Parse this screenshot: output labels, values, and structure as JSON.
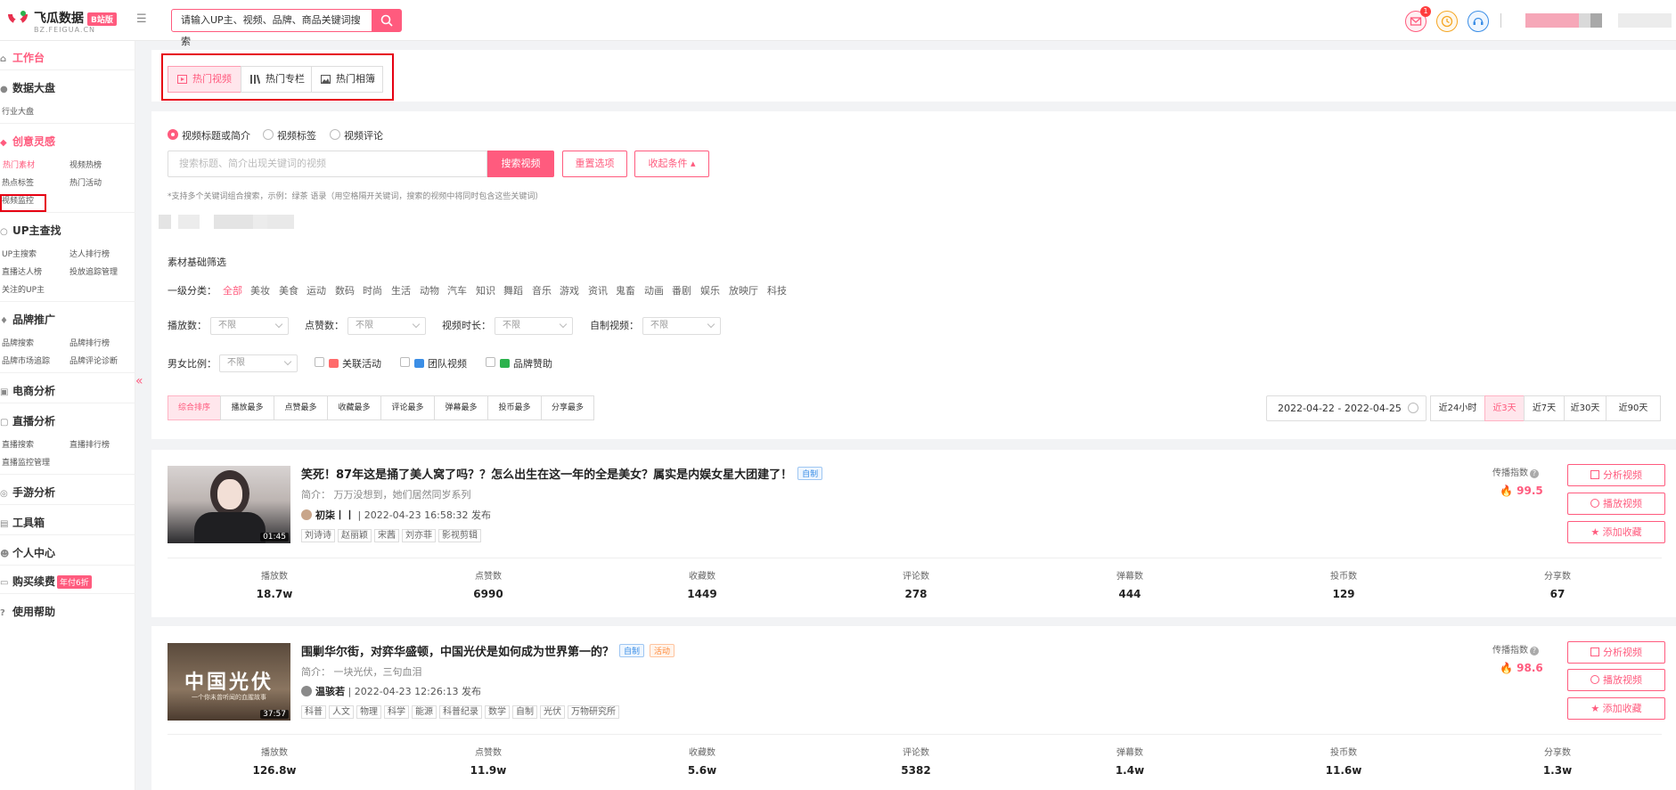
{
  "header": {
    "brand": "飞瓜数据",
    "brand_badge": "B站版",
    "brand_sub": "BZ.FEIGUA.CN",
    "search_placeholder": "请输入UP主、视频、品牌、商品关键词搜索",
    "notify_count": "1"
  },
  "sidebar": {
    "workbench": "工作台",
    "data_board": "数据大盘",
    "industry_board": "行业大盘",
    "inspiration": "创意灵感",
    "hot_material": "热门素材",
    "video_rank": "视频热榜",
    "hot_tags": "热点标签",
    "hot_activity": "热门活动",
    "video_monitor": "视频监控",
    "up_search": "UP主查找",
    "up_search_item": "UP主搜索",
    "talent_rank": "达人排行榜",
    "live_talent": "直播达人榜",
    "ad_manage": "投放追踪管理",
    "followed_up": "关注的UP主",
    "brand_promo": "品牌推广",
    "brand_search": "品牌搜索",
    "brand_rank": "品牌排行榜",
    "brand_market": "品牌市场追踪",
    "brand_diag": "品牌评论诊断",
    "ecommerce": "电商分析",
    "live_analysis": "直播分析",
    "live_search": "直播搜索",
    "live_rank": "直播排行榜",
    "live_monitor": "直播监控管理",
    "game_analysis": "手游分析",
    "toolbox": "工具箱",
    "personal": "个人中心",
    "buy_renew": "购买续费",
    "buy_badge": "年付6折",
    "help": "使用帮助"
  },
  "tabs": [
    "热门视频",
    "热门专栏",
    "热门相簿"
  ],
  "search_modes": [
    "视频标题或简介",
    "视频标签",
    "视频评论"
  ],
  "keyword_placeholder": "搜索标题、简介出现关键词的视频",
  "buttons": {
    "search": "搜索视频",
    "reset": "重置选项",
    "collapse": "收起条件"
  },
  "hint": "*支持多个关键词组合搜索，示例：绿茶 语录（用空格隔开关键词，搜索的视频中将同时包含这些关键词）",
  "filters": {
    "title": "素材基础筛选",
    "cat_label": "一级分类：",
    "categories": [
      "全部",
      "美妆",
      "美食",
      "运动",
      "数码",
      "时尚",
      "生活",
      "动物",
      "汽车",
      "知识",
      "舞蹈",
      "音乐",
      "游戏",
      "资讯",
      "鬼畜",
      "动画",
      "番剧",
      "娱乐",
      "放映厅",
      "科技"
    ],
    "play_label": "播放数：",
    "like_label": "点赞数：",
    "duration_label": "视频时长：",
    "self_label": "自制视频：",
    "gender_label": "男女比例：",
    "default_value": "不限",
    "related_activity": "关联活动",
    "team_video": "团队视频",
    "brand_sponsor": "品牌赞助"
  },
  "sort_tabs": [
    "综合排序",
    "播放最多",
    "点赞最多",
    "收藏最多",
    "评论最多",
    "弹幕最多",
    "投币最多",
    "分享最多"
  ],
  "date_range": "2022-04-22 - 2022-04-25",
  "range_tabs": [
    "近24小时",
    "近3天",
    "近7天",
    "近30天",
    "近90天"
  ],
  "video_labels": {
    "intro_prefix": "简介：",
    "spread": "传播指数",
    "analyze": "分析视频",
    "play": "播放视频",
    "collect": "添加收藏",
    "self_tag": "自制",
    "activity_tag": "活动",
    "stat_names": [
      "播放数",
      "点赞数",
      "收藏数",
      "评论数",
      "弹幕数",
      "投币数",
      "分享数"
    ]
  },
  "videos": [
    {
      "title": "笑死！87年这是捅了美人窝了吗？？怎么出生在这一年的全是美女？属实是内娱女星大团建了！",
      "intro": "万万没想到，她们居然同岁系列",
      "author": "初柒丨丨",
      "time": "| 2022-04-23 16:58:32 发布",
      "tags": [
        "刘诗诗",
        "赵丽颖",
        "宋茜",
        "刘亦菲",
        "影视剪辑"
      ],
      "duration": "01:45",
      "spread": "99.5",
      "stats": [
        "18.7w",
        "6990",
        "1449",
        "278",
        "444",
        "129",
        "67"
      ]
    },
    {
      "title": "围剿华尔街，对弈华盛顿，中国光伏是如何成为世界第一的？",
      "intro": "一块光伏，三句血泪",
      "author": "温骇若",
      "time": "| 2022-04-23 12:26:13 发布",
      "tags": [
        "科普",
        "人文",
        "物理",
        "科学",
        "能源",
        "科普纪录",
        "数学",
        "自制",
        "光伏",
        "万物研究所"
      ],
      "duration": "37:57",
      "thumb_title": "中国光伏",
      "thumb_sub": "一个你未曾听闻的血腥故事",
      "spread": "98.6",
      "stats": [
        "126.8w",
        "11.9w",
        "5.6w",
        "5382",
        "1.4w",
        "11.6w",
        "1.3w"
      ]
    }
  ],
  "colors": {
    "accent": "#ff5b7e",
    "highlight_box": "#e60012",
    "self_tag": "#3b8ee6",
    "activity_tag": "#ff8a3a"
  }
}
